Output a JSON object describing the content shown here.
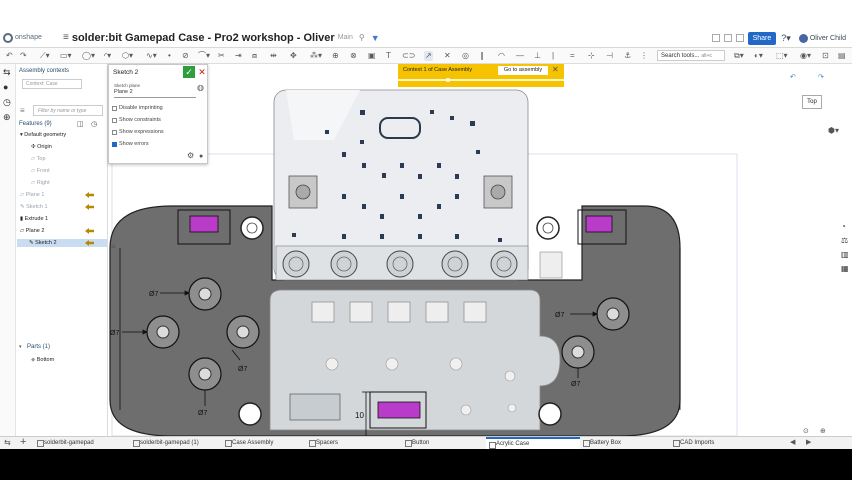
{
  "header": {
    "logo_text": "onshape",
    "document_title": "solder:bit Gamepad Case - Pro2 workshop - Oliver",
    "document_tag": "Main",
    "share_label": "Share",
    "user_name": "Oliver Child"
  },
  "toolbar": {
    "search_tools_label": "Search tools...",
    "search_tools_shortcut": "alt+c"
  },
  "left_panel": {
    "assembly_contexts_title": "Assembly contexts",
    "assembly_context_placeholder": "Context: Case",
    "filter_placeholder": "Filter by name or type",
    "features_header": "Features (9)",
    "tree_items": [
      {
        "label": "Default geometry",
        "state": "normal"
      },
      {
        "label": "Origin",
        "state": "normal"
      },
      {
        "label": "Top",
        "state": "dim"
      },
      {
        "label": "Front",
        "state": "dim"
      },
      {
        "label": "Right",
        "state": "dim"
      },
      {
        "label": "Plane 1",
        "state": "dim"
      },
      {
        "label": "Sketch 1",
        "state": "dim"
      },
      {
        "label": "Extrude 1",
        "state": "normal"
      },
      {
        "label": "Plane 2",
        "state": "normal"
      },
      {
        "label": "Sketch 2",
        "state": "selected"
      }
    ],
    "parts_header": "Parts (1)",
    "parts": [
      {
        "label": "Bottom"
      }
    ]
  },
  "sketch_dialog": {
    "title": "Sketch 2",
    "plane_label": "Sketch plane",
    "plane_value": "Plane 2",
    "options": [
      {
        "label": "Disable imprinting",
        "checked": false
      },
      {
        "label": "Show constraints",
        "checked": false
      },
      {
        "label": "Show expressions",
        "checked": false
      },
      {
        "label": "Show errors",
        "checked": true
      }
    ]
  },
  "banner": {
    "text": "Context 1 of Case Assembly",
    "button_label": "Go to assembly"
  },
  "view_cube": {
    "face_label": "Top"
  },
  "dimensions": {
    "d1": "Ø7",
    "d2": "Ø7",
    "d3": "Ø7",
    "d4": "Ø7",
    "d5": "Ø7",
    "d6": "Ø7",
    "d7": "10"
  },
  "tabs": [
    {
      "label": "solderbit-gamepad",
      "active": false
    },
    {
      "label": "solderbit-gamepad (1)",
      "active": false
    },
    {
      "label": "Case Assembly",
      "active": false
    },
    {
      "label": "Spacers",
      "active": false
    },
    {
      "label": "Button",
      "active": false
    },
    {
      "label": "Acrylic Case",
      "active": true
    },
    {
      "label": "Battery Box",
      "active": false
    },
    {
      "label": "CAD Imports",
      "active": false
    }
  ],
  "colors": {
    "accent": "#2268c7",
    "banner": "#f6c300",
    "case_body": "#6e6e6e",
    "highlight": "#b93bc9"
  }
}
